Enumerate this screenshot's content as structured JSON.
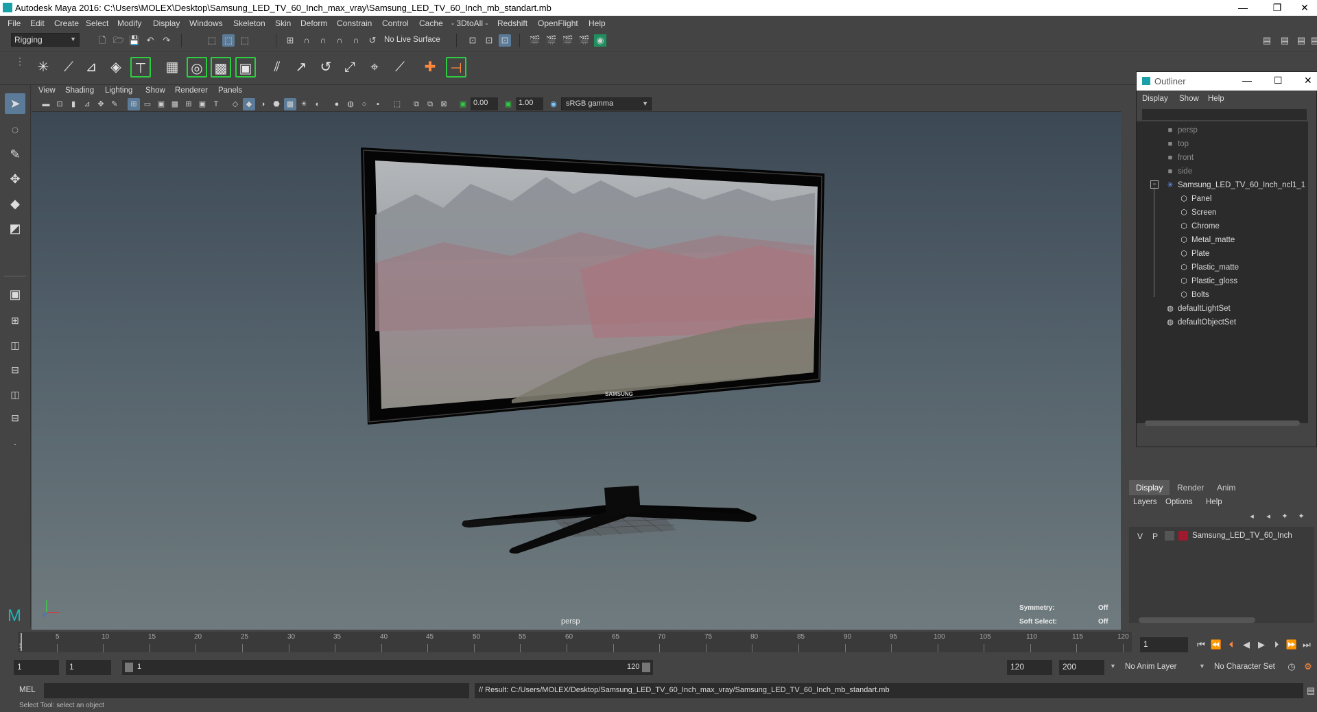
{
  "window": {
    "title": "Autodesk Maya 2016: C:\\Users\\MOLEX\\Desktop\\Samsung_LED_TV_60_Inch_max_vray\\Samsung_LED_TV_60_Inch_mb_standart.mb",
    "minimize": "—",
    "restore": "❐",
    "close": "✕"
  },
  "menubar": [
    "File",
    "Edit",
    "Create",
    "Select",
    "Modify",
    "Display",
    "Windows",
    "Skeleton",
    "Skin",
    "Deform",
    "Constrain",
    "Control",
    "Cache",
    "- 3DtoAll -",
    "Redshift",
    "OpenFlight",
    "Help"
  ],
  "statusline": {
    "menuset": "Rigging",
    "live_surface": "No Live Surface"
  },
  "viewport": {
    "menu": [
      "View",
      "Shading",
      "Lighting",
      "Show",
      "Renderer",
      "Panels"
    ],
    "exposure": "0.00",
    "gamma": "1.00",
    "color_space": "sRGB gamma",
    "camera_label": "persp",
    "hud": {
      "symmetry_label": "Symmetry:",
      "symmetry_value": "Off",
      "soft_select_label": "Soft Select:",
      "soft_select_value": "Off"
    },
    "tv_brand": "SAMSUNG"
  },
  "outliner": {
    "title": "Outliner",
    "menu": [
      "Display",
      "Show",
      "Help"
    ],
    "items": [
      {
        "label": "persp",
        "icon": "camera-icon",
        "depth": 1,
        "dim": true
      },
      {
        "label": "top",
        "icon": "camera-icon",
        "depth": 1,
        "dim": true
      },
      {
        "label": "front",
        "icon": "camera-icon",
        "depth": 1,
        "dim": true
      },
      {
        "label": "side",
        "icon": "camera-icon",
        "depth": 1,
        "dim": true
      },
      {
        "label": "Samsung_LED_TV_60_Inch_ncl1_1",
        "icon": "group-icon",
        "depth": 1,
        "dim": false
      },
      {
        "label": "Panel",
        "icon": "mesh-icon",
        "depth": 2,
        "dim": false
      },
      {
        "label": "Screen",
        "icon": "mesh-icon",
        "depth": 2,
        "dim": false
      },
      {
        "label": "Chrome",
        "icon": "mesh-icon",
        "depth": 2,
        "dim": false
      },
      {
        "label": "Metal_matte",
        "icon": "mesh-icon",
        "depth": 2,
        "dim": false
      },
      {
        "label": "Plate",
        "icon": "mesh-icon",
        "depth": 2,
        "dim": false
      },
      {
        "label": "Plastic_matte",
        "icon": "mesh-icon",
        "depth": 2,
        "dim": false
      },
      {
        "label": "Plastic_gloss",
        "icon": "mesh-icon",
        "depth": 2,
        "dim": false
      },
      {
        "label": "Bolts",
        "icon": "mesh-icon",
        "depth": 2,
        "dim": false
      },
      {
        "label": "defaultLightSet",
        "icon": "set-icon",
        "depth": 1,
        "dim": false
      },
      {
        "label": "defaultObjectSet",
        "icon": "set-icon",
        "depth": 1,
        "dim": false
      }
    ]
  },
  "layer_editor": {
    "tabs": [
      "Display",
      "Render",
      "Anim"
    ],
    "menu": [
      "Layers",
      "Options",
      "Help"
    ],
    "layer": {
      "v": "V",
      "p": "P",
      "name": "Samsung_LED_TV_60_Inch",
      "color": "#a0192c"
    }
  },
  "timeslider": {
    "ticks": [
      "5",
      "10",
      "15",
      "20",
      "25",
      "30",
      "35",
      "40",
      "45",
      "50",
      "55",
      "60",
      "65",
      "70",
      "75",
      "80",
      "85",
      "90",
      "95",
      "100",
      "105",
      "110",
      "115",
      "120"
    ],
    "current_marker": "1",
    "current_frame": "1"
  },
  "rangeslider": {
    "start": "1",
    "playback_start": "1",
    "range_start": "1",
    "range_end": "120",
    "playback_end": "120",
    "end": "200",
    "anim_layer": "No Anim Layer",
    "character_set": "No Character Set"
  },
  "cmdline": {
    "lang": "MEL",
    "result": "// Result: C:/Users/MOLEX/Desktop/Samsung_LED_TV_60_Inch_max_vray/Samsung_LED_TV_60_Inch_mb_standart.mb"
  },
  "helpline": "Select Tool: select an object"
}
